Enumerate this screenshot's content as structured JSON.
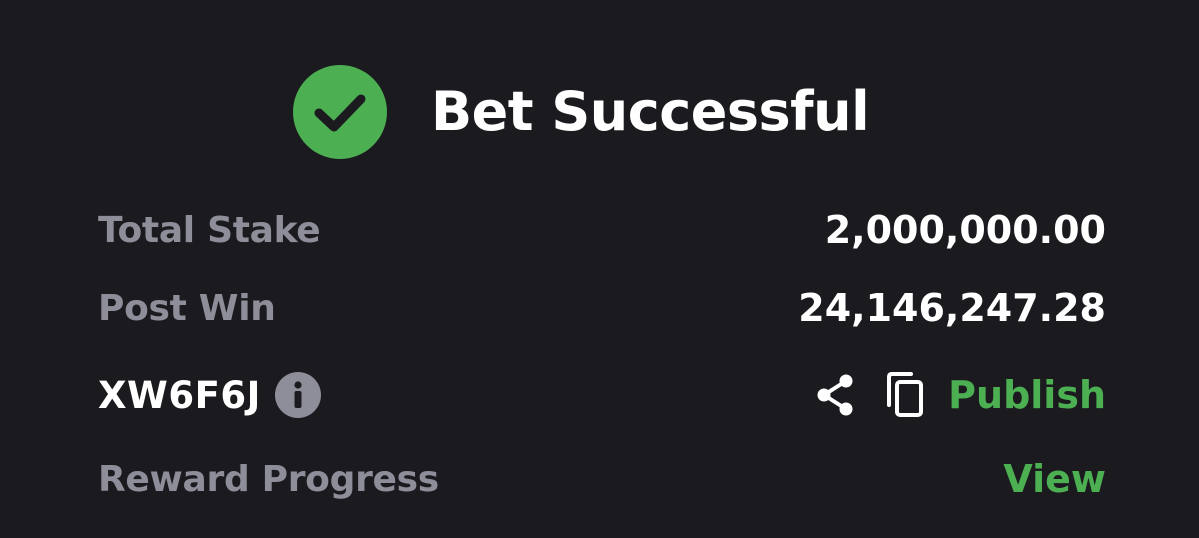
{
  "colors": {
    "background": "#1b1b1f",
    "accent_green": "#4cb052",
    "label_gray": "#8e8e9a",
    "text_white": "#ffffff"
  },
  "header": {
    "icon": "check-circle-icon",
    "title": "Bet Successful"
  },
  "rows": {
    "total_stake": {
      "label": "Total Stake",
      "value": "2,000,000.00"
    },
    "post_win": {
      "label": "Post Win",
      "value": "24,146,247.28"
    },
    "bet_code": {
      "code": "XW6F6J",
      "info_icon": "info-icon",
      "share_icon": "share-icon",
      "copy_icon": "copy-icon",
      "publish_label": "Publish"
    },
    "reward_progress": {
      "label": "Reward Progress",
      "view_label": "View"
    }
  }
}
